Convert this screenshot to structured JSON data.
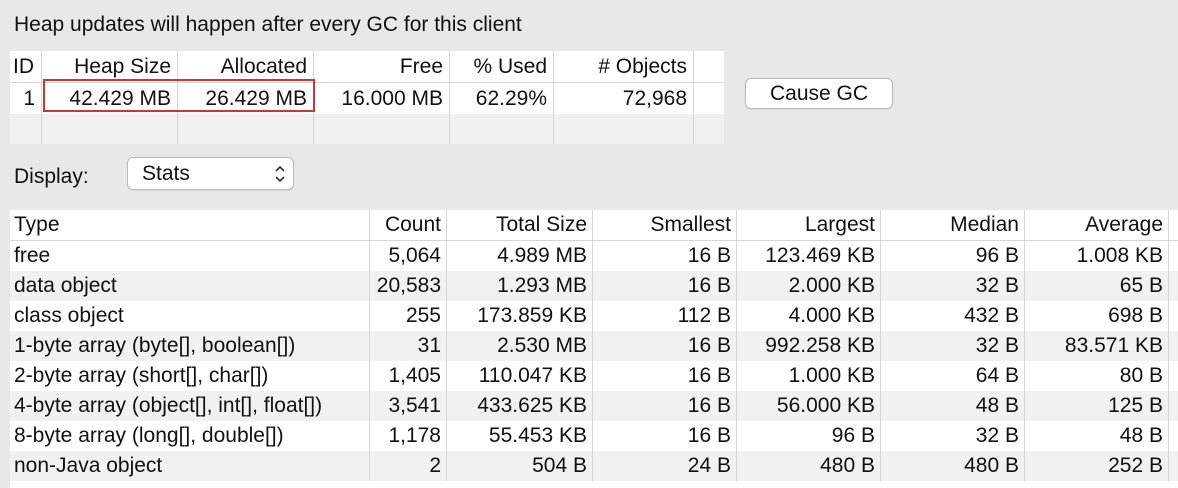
{
  "header": {
    "text": "Heap updates will happen after every GC for this client"
  },
  "heap_table": {
    "columns": [
      "ID",
      "Heap Size",
      "Allocated",
      "Free",
      "% Used",
      "# Objects"
    ],
    "rows": [
      [
        "1",
        "42.429 MB",
        "26.429 MB",
        "16.000 MB",
        "62.29%",
        "72,968"
      ]
    ]
  },
  "cause_gc_label": "Cause GC",
  "display": {
    "label": "Display:",
    "selected": "Stats"
  },
  "stats_table": {
    "columns": [
      "Type",
      "Count",
      "Total Size",
      "Smallest",
      "Largest",
      "Median",
      "Average"
    ],
    "rows": [
      [
        "free",
        "5,064",
        "4.989 MB",
        "16 B",
        "123.469 KB",
        "96 B",
        "1.008 KB"
      ],
      [
        "data object",
        "20,583",
        "1.293 MB",
        "16 B",
        "2.000 KB",
        "32 B",
        "65 B"
      ],
      [
        "class object",
        "255",
        "173.859 KB",
        "112 B",
        "4.000 KB",
        "432 B",
        "698 B"
      ],
      [
        "1-byte array (byte[], boolean[])",
        "31",
        "2.530 MB",
        "16 B",
        "992.258 KB",
        "32 B",
        "83.571 KB"
      ],
      [
        "2-byte array (short[], char[])",
        "1,405",
        "110.047 KB",
        "16 B",
        "1.000 KB",
        "64 B",
        "80 B"
      ],
      [
        "4-byte array (object[], int[], float[])",
        "3,541",
        "433.625 KB",
        "16 B",
        "56.000 KB",
        "48 B",
        "125 B"
      ],
      [
        "8-byte array (long[], double[])",
        "1,178",
        "55.453 KB",
        "16 B",
        "96 B",
        "32 B",
        "48 B"
      ],
      [
        "non-Java object",
        "2",
        "504 B",
        "24 B",
        "480 B",
        "480 B",
        "252 B"
      ]
    ]
  },
  "colors": {
    "highlight": "#c8382c",
    "window_bg": "#e8e8e8",
    "alt_row": "#f1f1f1"
  }
}
